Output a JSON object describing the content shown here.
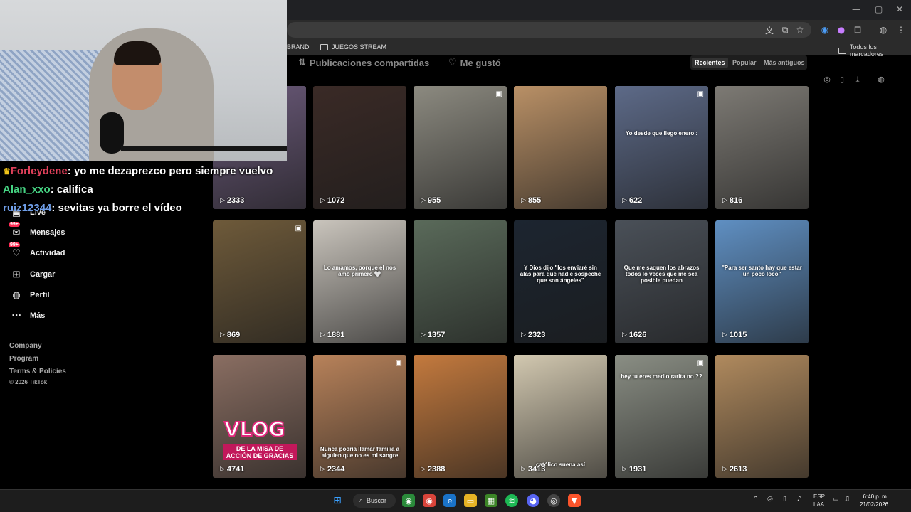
{
  "browser": {
    "bookmarks": [
      "BRAND",
      "JUEGOS STREAM"
    ],
    "bookmarks_right": "Todos los marcadores"
  },
  "chat": [
    {
      "user": "Forleydene",
      "text": ": yo me dezaprezco pero siempre vuelvo",
      "color": "#e0405a"
    },
    {
      "user": "Alan_xxo",
      "text": ": califica",
      "color": "#46d483"
    },
    {
      "user": "ruiz12344",
      "text": ": sevitas ya borre el vídeo",
      "color": "#6f9ee8"
    }
  ],
  "sidebar": {
    "items": [
      {
        "label": "Live",
        "icon": "live-icon"
      },
      {
        "label": "Mensajes",
        "icon": "messages-icon",
        "badge": "99+"
      },
      {
        "label": "Actividad",
        "icon": "activity-icon",
        "badge": "99+"
      },
      {
        "label": "Cargar",
        "icon": "upload-icon"
      },
      {
        "label": "Perfil",
        "icon": "profile-icon"
      },
      {
        "label": "Más",
        "icon": "more-icon"
      }
    ],
    "footer": [
      "Company",
      "Program",
      "Terms & Policies",
      "© 2026 TikTok"
    ]
  },
  "tabs": {
    "shared": "Publicaciones compartidas",
    "liked": "Me gustó"
  },
  "sort": [
    "Recientes",
    "Popular",
    "Más antiguos"
  ],
  "videos": [
    {
      "views": "2333",
      "bg": "#6b5a7a"
    },
    {
      "views": "1072",
      "bg": "#3a2a26"
    },
    {
      "views": "955",
      "bg": "#8c8a80",
      "caption": ""
    },
    {
      "views": "855",
      "bg": "#b99066"
    },
    {
      "views": "622",
      "bg": "#5d6a88",
      "caption": "Yo desde que llego enero :"
    },
    {
      "views": "816",
      "bg": "#7d7a74"
    },
    {
      "views": "869",
      "bg": "#6e5a3a"
    },
    {
      "views": "1881",
      "bg": "#c9c4bc",
      "caption": "Lo amamos, porque el nos amó primero 🤍"
    },
    {
      "views": "1357",
      "bg": "#5a6a5a"
    },
    {
      "views": "2323",
      "bg": "#1c2530",
      "caption": "Y Dios dijo \"los enviaré sin alas para que nadie sospeche que son ángeles\""
    },
    {
      "views": "1626",
      "bg": "#4a5058",
      "caption": "Que me saquen los abrazos todos lo veces que me sea posible puedan"
    },
    {
      "views": "1015",
      "bg": "#5f8fc2",
      "caption": "\"Para ser santo hay que estar un poco loco\""
    },
    {
      "views": "4741",
      "bg": "#8a6e62",
      "vlog": "VLOG",
      "vlog_sub": "DE LA MISA DE ACCIÓN DE GRACIAS"
    },
    {
      "views": "2344",
      "bg": "#b8825a",
      "caption": "Nunca podría llamar familia a alguien que no es mi sangre"
    },
    {
      "views": "2388",
      "bg": "#c47a3e"
    },
    {
      "views": "3413",
      "bg": "#d2c8b0",
      "caption": "católico suena así"
    },
    {
      "views": "1931",
      "bg": "#8a8e84",
      "caption": "hey tu eres medio rarita no ??"
    },
    {
      "views": "2613",
      "bg": "#b08a5e"
    }
  ],
  "taskbar": {
    "search_label": "Buscar",
    "lang": "ESP",
    "lang_sub": "LAA",
    "time": "6:40 p. m.",
    "date": "21/02/2026"
  }
}
